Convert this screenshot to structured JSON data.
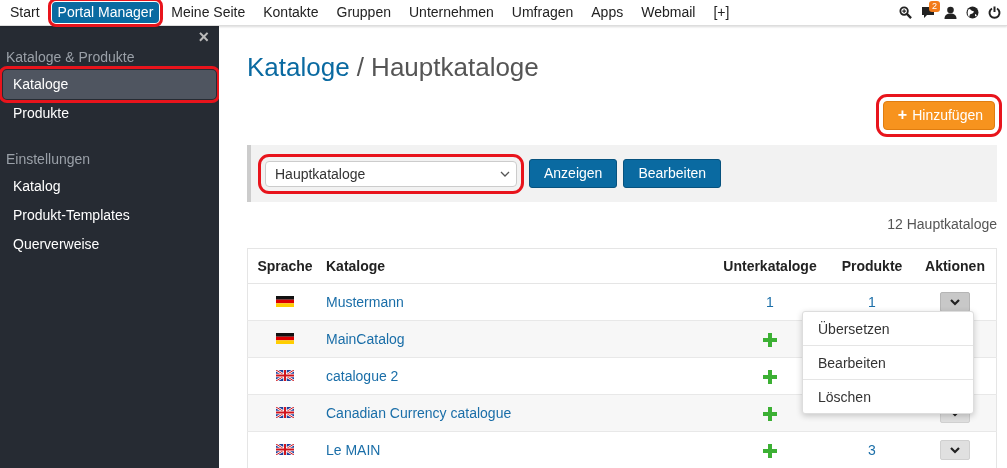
{
  "top_nav": {
    "items": [
      {
        "label": "Start",
        "selected": false,
        "highlighted": false
      },
      {
        "label": "Portal Manager",
        "selected": true,
        "highlighted": true
      },
      {
        "label": "Meine Seite",
        "selected": false,
        "highlighted": false
      },
      {
        "label": "Kontakte",
        "selected": false,
        "highlighted": false
      },
      {
        "label": "Gruppen",
        "selected": false,
        "highlighted": false
      },
      {
        "label": "Unternehmen",
        "selected": false,
        "highlighted": false
      },
      {
        "label": "Umfragen",
        "selected": false,
        "highlighted": false
      },
      {
        "label": "Apps",
        "selected": false,
        "highlighted": false
      },
      {
        "label": "Webmail",
        "selected": false,
        "highlighted": false
      },
      {
        "label": "[+]",
        "selected": false,
        "highlighted": false
      }
    ],
    "messages_badge": "2"
  },
  "sidebar": {
    "close": "×",
    "sections": [
      {
        "title": "Kataloge & Produkte",
        "items": [
          {
            "label": "Kataloge",
            "selected": true,
            "highlighted": true
          },
          {
            "label": "Produkte",
            "selected": false,
            "highlighted": false
          }
        ]
      },
      {
        "title": "Einstellungen",
        "items": [
          {
            "label": "Katalog",
            "selected": false,
            "highlighted": false
          },
          {
            "label": "Produkt-Templates",
            "selected": false,
            "highlighted": false
          },
          {
            "label": "Querverweise",
            "selected": false,
            "highlighted": false
          }
        ]
      }
    ]
  },
  "page": {
    "title_link": "Kataloge",
    "title_rest": "/ Hauptkataloge",
    "add_button": {
      "icon": "+",
      "label": "Hinzufügen",
      "highlighted": true
    },
    "filter": {
      "select_value": "Hauptkataloge",
      "select_highlighted": true,
      "buttons": [
        "Anzeigen",
        "Bearbeiten"
      ]
    },
    "count": "12 Hauptkataloge",
    "table": {
      "columns": [
        "Sprache",
        "Kataloge",
        "Unterkataloge",
        "Produkte",
        "Aktionen"
      ],
      "rows": [
        {
          "flag": {
            "kind": "german"
          },
          "name": "Mustermann",
          "subcatalogs": {
            "kind": "link",
            "text": "1"
          },
          "products": "1",
          "action_button": true,
          "menu_open": true
        },
        {
          "flag": {
            "kind": "german"
          },
          "name": "MainCatalog",
          "subcatalogs": {
            "kind": "add"
          }
        },
        {
          "flag": {
            "kind": "british"
          },
          "name": "catalogue 2",
          "subcatalogs": {
            "kind": "add"
          }
        },
        {
          "flag": {
            "kind": "british"
          },
          "name": "Canadian Currency catalogue",
          "subcatalogs": {
            "kind": "add"
          },
          "action_button": true,
          "menu_open": false
        },
        {
          "flag": {
            "kind": "british"
          },
          "name": "Le MAIN",
          "subcatalogs": {
            "kind": "add"
          },
          "products": "3",
          "action_button": true,
          "menu_open": false
        }
      ],
      "action_menu": {
        "items": [
          "Übersetzen",
          "Bearbeiten",
          "Löschen"
        ]
      }
    }
  }
}
